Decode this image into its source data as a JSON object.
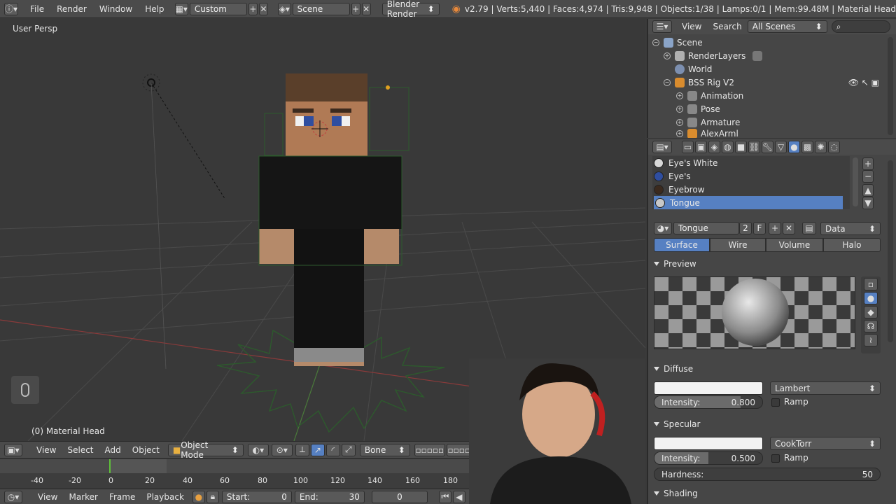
{
  "topbar": {
    "menus": [
      "File",
      "Render",
      "Window",
      "Help"
    ],
    "layout": "Custom",
    "scene": "Scene",
    "engine": "Blender Render",
    "stats": "v2.79 | Verts:5,440 | Faces:4,974 | Tris:9,948 | Objects:1/38 | Lamps:0/1 | Mem:99.48M | Material Head"
  },
  "viewport": {
    "view_name": "User Persp",
    "object_label": "(0) Material Head",
    "header": {
      "menus": [
        "View",
        "Select",
        "Add",
        "Object"
      ],
      "mode": "Object Mode",
      "bone": "Bone"
    }
  },
  "timeline": {
    "ticks": [
      "-40",
      "-20",
      "0",
      "20",
      "40",
      "60",
      "80",
      "100",
      "120",
      "140",
      "160",
      "180"
    ],
    "menus": [
      "View",
      "Marker",
      "Frame",
      "Playback"
    ],
    "start_label": "Start:",
    "start_value": "0",
    "end_label": "End:",
    "end_value": "30",
    "current": "0"
  },
  "outliner": {
    "menus": [
      "View",
      "Search"
    ],
    "scene_filter": "All Scenes",
    "items": [
      {
        "label": "Scene",
        "indent": 0,
        "color": "#8aa4c8"
      },
      {
        "label": "RenderLayers",
        "indent": 1,
        "color": "#b0b0b0"
      },
      {
        "label": "World",
        "indent": 1,
        "color": "#7c8fb0"
      },
      {
        "label": "BSS Rig V2",
        "indent": 1,
        "color": "#d98c2e"
      },
      {
        "label": "Animation",
        "indent": 2,
        "color": "#cccccc"
      },
      {
        "label": "Pose",
        "indent": 2,
        "color": "#cccccc"
      },
      {
        "label": "Armature",
        "indent": 2,
        "color": "#cccccc"
      },
      {
        "label": "AlexArml",
        "indent": 2,
        "color": "#d98c2e"
      }
    ]
  },
  "properties": {
    "materials": [
      {
        "label": "Eye's White",
        "color": "#d8d8d8",
        "selected": false
      },
      {
        "label": "Eye's",
        "color": "#2f4ea0",
        "selected": false
      },
      {
        "label": "Eyebrow",
        "color": "#3b2a1e",
        "selected": false
      },
      {
        "label": "Tongue",
        "color": "#c8c8c8",
        "selected": true
      }
    ],
    "material_name": "Tongue",
    "users": "2",
    "fake": "F",
    "link": "Data",
    "tabs": [
      "Surface",
      "Wire",
      "Volume",
      "Halo"
    ],
    "active_tab": "Surface",
    "preview_label": "Preview",
    "diffuse": {
      "label": "Diffuse",
      "shader": "Lambert",
      "intensity_label": "Intensity:",
      "intensity": "0.800",
      "intensity_fraction": 0.8,
      "ramp": "Ramp"
    },
    "specular": {
      "label": "Specular",
      "shader": "CookTorr",
      "intensity_label": "Intensity:",
      "intensity": "0.500",
      "intensity_fraction": 0.5,
      "ramp": "Ramp",
      "hardness_label": "Hardness:",
      "hardness": "50"
    },
    "shading_label": "Shading"
  }
}
